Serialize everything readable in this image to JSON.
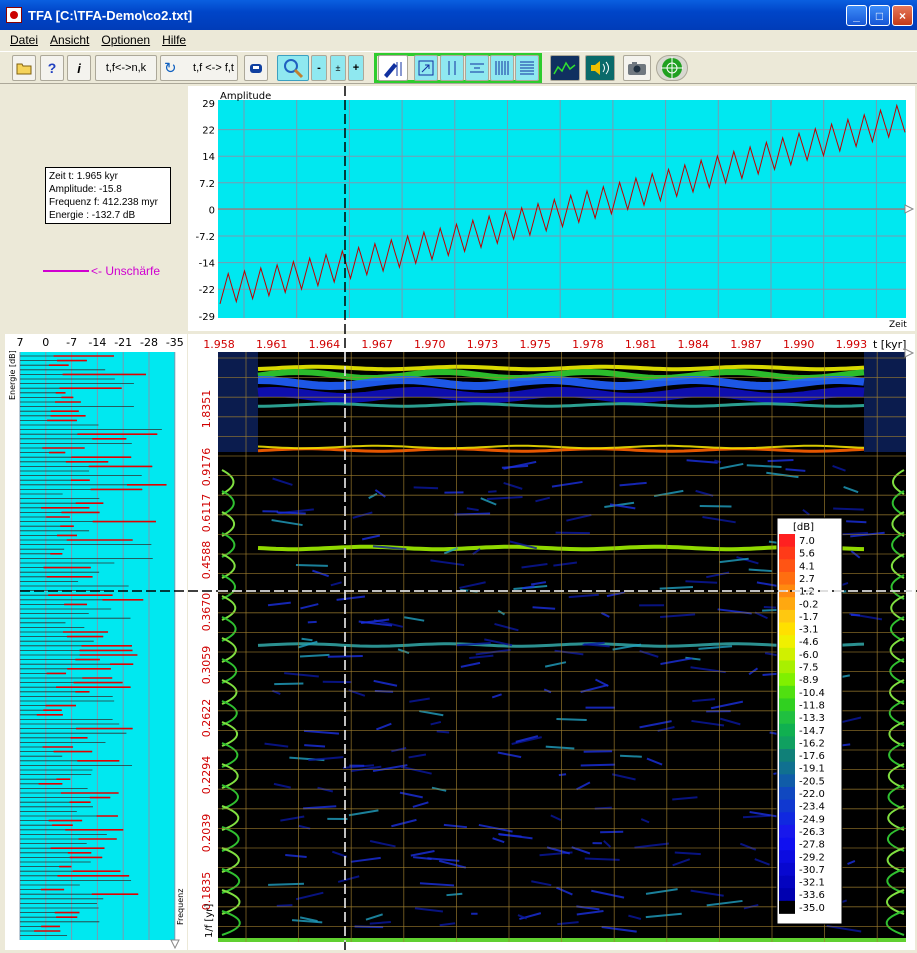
{
  "window": {
    "title": "TFA [C:\\TFA-Demo\\co2.txt]",
    "minimize": "_",
    "maximize": "□",
    "close": "×"
  },
  "menu": [
    "Datei",
    "Ansicht",
    "Optionen",
    "Hilfe"
  ],
  "toolbar": {
    "btn_tfnk": "t,f<->n,k",
    "btn_tfft": "t,f <-> f,t"
  },
  "info": {
    "zeit": "Zeit t:  1.965 kyr",
    "amplitude": "Amplitude:  -15.8",
    "frequenz": "Frequenz f:  412.238 myr",
    "energie": "Energie :  -132.7 dB"
  },
  "unschaerfe_label": "<- Unschärfe",
  "signal": {
    "title": "Amplitude",
    "xlabel": "Zeit",
    "yticks": [
      "29",
      "22",
      "14",
      "7.2",
      "0",
      "-7.2",
      "-14",
      "-22",
      "-29"
    ]
  },
  "energy": {
    "ylabel": "Energie [dB]",
    "xticks": [
      "7",
      "0",
      "-7",
      "-14",
      "-21",
      "-28",
      "-35"
    ],
    "freq_label": "Frequenz"
  },
  "spectrogram": {
    "tlabel": "t [kyr]",
    "flabel": "1/f [yr]",
    "tticks": [
      "1.958",
      "1.961",
      "1.964",
      "1.967",
      "1.970",
      "1.973",
      "1.975",
      "1.978",
      "1.981",
      "1.984",
      "1.987",
      "1.990",
      "1.993"
    ],
    "fticks": [
      "1.8351",
      "0.9176",
      "0.6117",
      "0.4588",
      "0.3670",
      "0.3059",
      "0.2622",
      "0.2294",
      "0.2039",
      "0.1835"
    ]
  },
  "colorbar": {
    "title": "[dB]",
    "labels": [
      "7.0",
      "5.6",
      "4.1",
      "2.7",
      "1.2",
      "-0.2",
      "-1.7",
      "-3.1",
      "-4.6",
      "-6.0",
      "-7.5",
      "-8.9",
      "-10.4",
      "-11.8",
      "-13.3",
      "-14.7",
      "-16.2",
      "-17.6",
      "-19.1",
      "-20.5",
      "-22.0",
      "-23.4",
      "-24.9",
      "-26.3",
      "-27.8",
      "-29.2",
      "-30.7",
      "-32.1",
      "-33.6",
      "-35.0"
    ]
  },
  "colors": {
    "cyan": "#00e8f0",
    "trace": "#c00000",
    "bar": "#e00000"
  }
}
